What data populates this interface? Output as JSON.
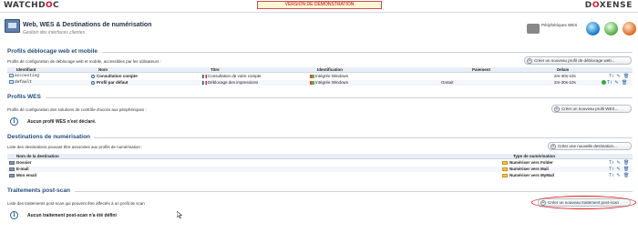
{
  "topbar": {
    "logo_left_a": "WATCHD",
    "logo_left_x": "O",
    "logo_left_b": "C",
    "logo_right_a": "D",
    "logo_right_x": "O",
    "logo_right_b": "XENSE",
    "demo_banner": "VERSION DE DÉMONSTRATION"
  },
  "header": {
    "title": "Web, WES & Destinations de numérisation",
    "subtitle": "Gestion des interfaces clientes",
    "peripherals_label": "Périphériques WES",
    "icons": [
      "user-settings-icon",
      "globe-icon",
      "green-globe-icon",
      "bell-icon"
    ]
  },
  "sections": {
    "web_profiles": {
      "title": "Profils déblocage web et mobile",
      "desc": "Profils de configuration de déblocage web et mobile, accessibles par les utilisateurs :",
      "button": "Créer un nouveau profil de déblocage web...",
      "columns": [
        "Identifiant",
        "Nom",
        "Titre",
        "Identification",
        "Paiement",
        "Délais"
      ],
      "rows": [
        {
          "id": "accounting",
          "name": "Consultation compte",
          "title": "Consultation de votre compte",
          "ident": "Intégrée Windows",
          "payment": "",
          "delay": "2m-30s-10s"
        },
        {
          "id": "default",
          "name": "Profil par défaut",
          "title": "Déblocage des impressions",
          "ident": "Intégrée Windows",
          "payment": "Gratuit",
          "delay": "2m-30s-10s"
        }
      ]
    },
    "wes_profiles": {
      "title": "Profils WES",
      "desc": "Profils de configuration des solutions de contrôle d'accès aux périphériques :",
      "button": "Créer un nouveau profil WES...",
      "empty": "Aucun profil WES n'est déclaré."
    },
    "destinations": {
      "title": "Destinations de numérisation",
      "desc": "Liste des destinations pouvant être associées aux profils de numérisation :",
      "button": "Créer une nouvelle destination...",
      "columns": [
        "Nom de la destination",
        "Type de numérisation"
      ],
      "rows": [
        {
          "name": "Dossier",
          "type": "Numériser vers Folder"
        },
        {
          "name": "E-mail",
          "type": "Numériser vers Mail"
        },
        {
          "name": "Mon email",
          "type": "Numériser vers MyMail"
        }
      ]
    },
    "post_scan": {
      "title": "Traitements post-scan",
      "desc": "Liste des traitements post-scan qui peuvent être affectés à un profil de scan",
      "button": "Créer un nouveau traitement post-scan",
      "empty": "Aucun traitement post-scan n'a été défini"
    }
  },
  "row_actions": "Ti ✎ 🗑"
}
